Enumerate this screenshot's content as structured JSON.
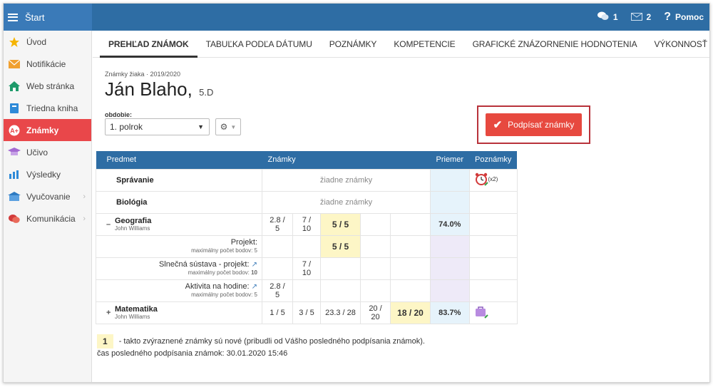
{
  "topbar": {
    "start": "Štart",
    "messages_count": "1",
    "mail_count": "2",
    "help": "Pomoc"
  },
  "sidebar": {
    "items": [
      {
        "label": "Úvod",
        "icon": "star-icon"
      },
      {
        "label": "Notifikácie",
        "icon": "envelope-icon"
      },
      {
        "label": "Web stránka",
        "icon": "home-icon"
      },
      {
        "label": "Triedna kniha",
        "icon": "book-icon"
      },
      {
        "label": "Známky",
        "icon": "grades-icon",
        "active": true
      },
      {
        "label": "Učivo",
        "icon": "graduation-icon"
      },
      {
        "label": "Výsledky",
        "icon": "bar-chart-icon"
      },
      {
        "label": "Vyučovanie",
        "icon": "school-icon"
      },
      {
        "label": "Komunikácia",
        "icon": "chat-icon"
      }
    ]
  },
  "tabs": [
    "PREHĽAD ZNÁMOK",
    "TABUĽKA PODĽA DÁTUMU",
    "POZNÁMKY",
    "KOMPETENCIE",
    "GRAFICKÉ ZNÁZORNENIE HODNOTENIA",
    "VÝKONNOSŤ ŠTUDENTA"
  ],
  "header": {
    "subtitle": "Známky žiaka · 2019/2020",
    "student": "Ján Blaho,",
    "class": "5.D"
  },
  "period": {
    "label": "obdobie:",
    "value": "1. polrok"
  },
  "sign_button": "Podpísať známky",
  "table": {
    "headers": {
      "subject": "Predmet",
      "grades": "Známky",
      "avg": "Priemer",
      "notes": "Poznámky"
    },
    "rows": {
      "spravanie": {
        "name": "Správanie",
        "empty": "žiadne známky",
        "note_count": "(x2)"
      },
      "biologia": {
        "name": "Biológia",
        "empty": "žiadne známky"
      },
      "geografia": {
        "toggle": "–",
        "name": "Geografia",
        "teacher": "John Williams",
        "g1": "2.8 / 5",
        "g2": "7 / 10",
        "g3": "5 / 5",
        "avg": "74.0%"
      },
      "projekt": {
        "name": "Projekt:",
        "max": "maximálny počet bodov: 5",
        "g3": "5 / 5"
      },
      "slnecna": {
        "name": "Slnečná sústava - projekt:",
        "max_prefix": "maximálny počet bodov: ",
        "max_val": "10",
        "g2": "7 / 10"
      },
      "aktivita": {
        "name": "Aktivita na hodine:",
        "max": "maximálny počet bodov: 5",
        "g1": "2.8 / 5"
      },
      "matematika": {
        "toggle": "+",
        "name": "Matematika",
        "teacher": "John Williams",
        "g1": "1 / 5",
        "g2": "3 / 5",
        "g3": "23.3 / 28",
        "g4": "20 / 20",
        "g5": "18 / 20",
        "avg": "83.7%"
      }
    }
  },
  "legend": {
    "badge": "1",
    "text": "- takto zvýraznené známky sú nové (pribudli od Vášho posledného podpísania známok)."
  },
  "last_sign": "čas posledného podpísania známok: 30.01.2020 15:46"
}
